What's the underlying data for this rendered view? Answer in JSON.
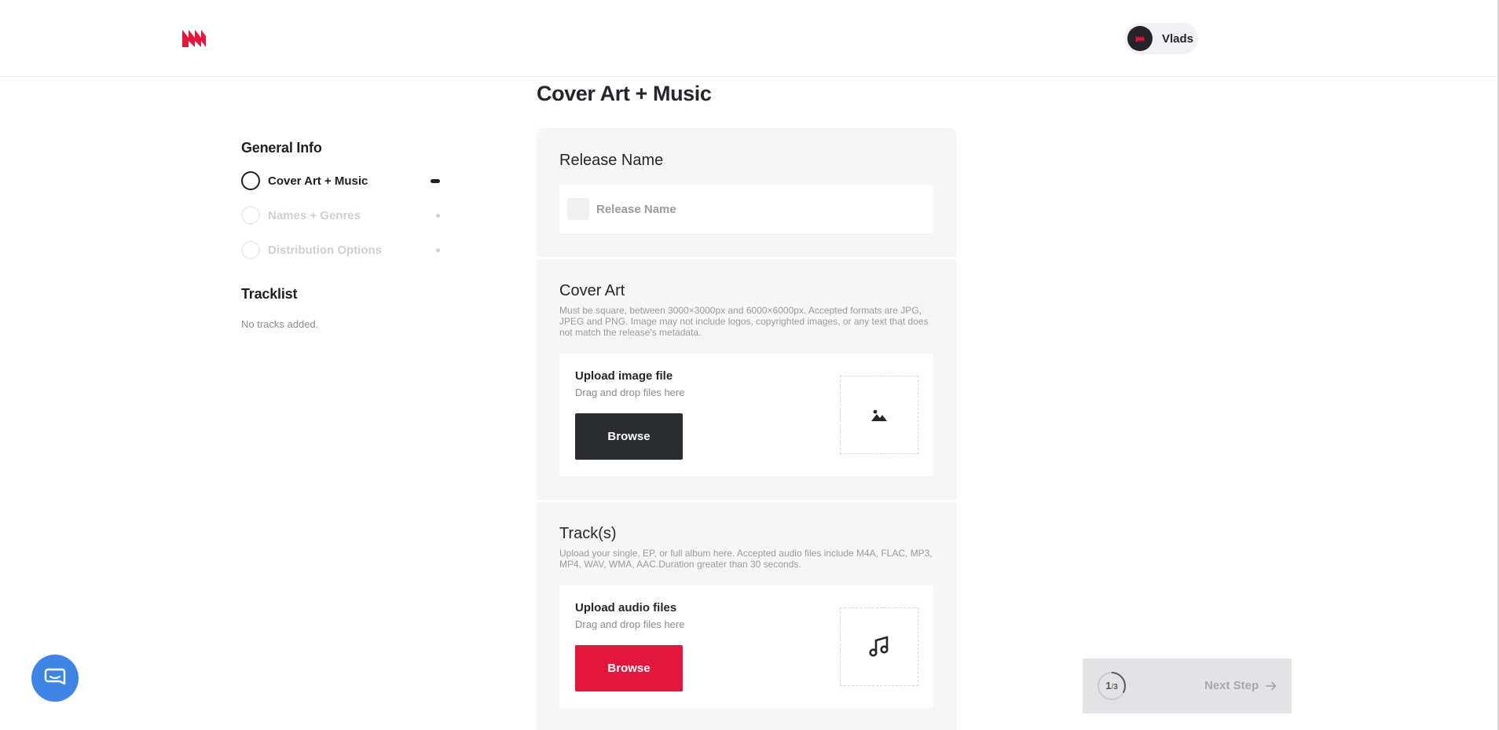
{
  "header": {
    "user_name": "Vlads"
  },
  "sidebar": {
    "general_heading": "General Info",
    "steps": [
      {
        "label": "Cover Art + Music",
        "state": "active"
      },
      {
        "label": "Names + Genres",
        "state": "inactive"
      },
      {
        "label": "Distribution Options",
        "state": "inactive"
      }
    ],
    "tracklist_heading": "Tracklist",
    "tracklist_empty": "No tracks added."
  },
  "main": {
    "page_title": "Cover Art + Music",
    "release": {
      "title": "Release Name",
      "placeholder": "Release Name"
    },
    "cover_art": {
      "title": "Cover Art",
      "description": "Must be square, between 3000×3000px and 6000×6000px. Accepted formats are JPG, JPEG and PNG. Image may not include logos, copyrighted images, or any text that does not match the release's metadata.",
      "upload_title": "Upload image file",
      "upload_sub": "Drag and drop files here",
      "browse_label": "Browse",
      "drop_icon": "image-icon"
    },
    "tracks": {
      "title": "Track(s)",
      "description": "Upload your single, EP, or full album here. Accepted audio files include M4A, FLAC, MP3, MP4, WAV, WMA, AAC.Duration greater than 30 seconds.",
      "upload_title": "Upload audio files",
      "upload_sub": "Drag and drop files here",
      "browse_label": "Browse",
      "drop_icon": "music-note-icon"
    }
  },
  "footer": {
    "progress_current": "1",
    "progress_total": "3",
    "next_label": "Next Step"
  },
  "colors": {
    "accent_red": "#e5163e",
    "dark_button": "#2b2c30",
    "help_blue": "#3f85e6"
  }
}
